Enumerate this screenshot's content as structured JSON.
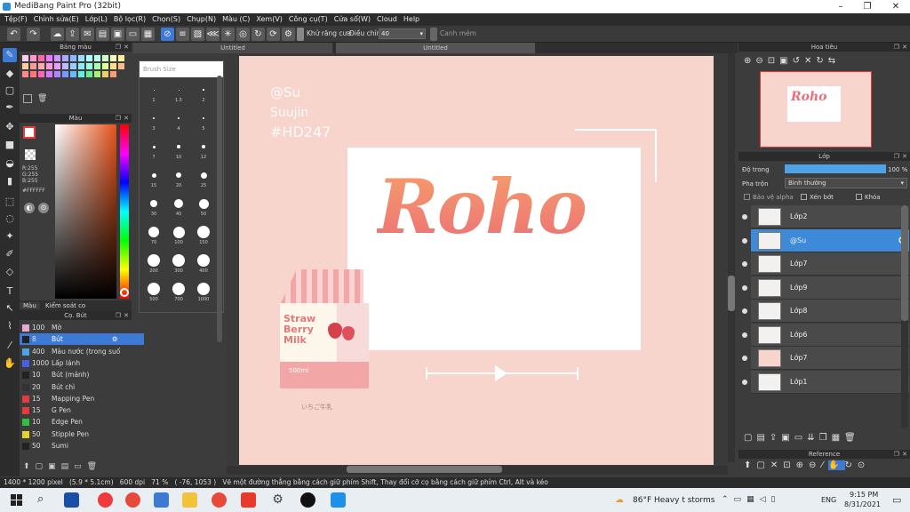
{
  "window": {
    "title": "MediBang Paint Pro (32bit)"
  },
  "menu": [
    "Tệp(F)",
    "Chỉnh sửa(E)",
    "Lớp(L)",
    "Bộ lọc(R)",
    "Chọn(S)",
    "Chụp(N)",
    "Màu (C)",
    "Xem(V)",
    "Công cụ(T)",
    "Cửa sổ(W)",
    "Cloud",
    "Help"
  ],
  "toolbar": {
    "antialias_label": "Khử răng cưa",
    "adjust_label": "Điều chỉnh",
    "adjust_value": "40",
    "snap_label": "Canh mém"
  },
  "palette": {
    "title": "Bảng màu"
  },
  "color": {
    "title": "Màu",
    "rgb": [
      "R:255",
      "G:255",
      "B:255"
    ],
    "hex": "#FFFFFF",
    "tab1": "Màu",
    "tab2": "Kiểm soát co"
  },
  "brush": {
    "title": "Cọ. Bút",
    "items": [
      {
        "size": "100",
        "name": "Mờ",
        "color": "#e8a8d0"
      },
      {
        "size": "8",
        "name": "Bút",
        "color": "#222222"
      },
      {
        "size": "400",
        "name": "Màu nước (trong suố",
        "color": "#49a7e8"
      },
      {
        "size": "1000",
        "name": "Lấp lánh",
        "color": "#4a5ee8"
      },
      {
        "size": "10",
        "name": "Bút (mảnh)",
        "color": "#222222"
      },
      {
        "size": "20",
        "name": "Bút chì",
        "color": "#333333"
      },
      {
        "size": "15",
        "name": "Mapping Pen",
        "color": "#e83a3a"
      },
      {
        "size": "15",
        "name": "G Pen",
        "color": "#e83a3a"
      },
      {
        "size": "10",
        "name": "Edge Pen",
        "color": "#2ec23a"
      },
      {
        "size": "50",
        "name": "Stipple Pen",
        "color": "#e8d22a"
      },
      {
        "size": "50",
        "name": "Sumi",
        "color": "#222222"
      }
    ]
  },
  "brush_size": {
    "title": "Brush Size",
    "labels": [
      "1",
      "1.5",
      "2",
      "3",
      "4",
      "5",
      "7",
      "10",
      "12",
      "15",
      "20",
      "25",
      "30",
      "40",
      "50",
      "70",
      "100",
      "150",
      "200",
      "300",
      "400",
      "500",
      "700",
      "1000"
    ]
  },
  "tabs": [
    "Untitled",
    "Untitled"
  ],
  "canvas": {
    "handle1": "@Su",
    "handle2": "Suujin",
    "tag": "#HD247",
    "title": "Roho",
    "carton_l1": "Straw",
    "carton_l2": "Berry",
    "carton_l3": "Milk",
    "carton_vol": "500ml",
    "jp": "いちご牛乳"
  },
  "navigator": {
    "title": "Hoa tiêu"
  },
  "layers": {
    "title": "Lớp",
    "opacity_label": "Độ trong",
    "opacity_value": "100 %",
    "opacity_frac": 1.0,
    "blend_label": "Pha trộn",
    "blend_value": "Bình thường",
    "protect_alpha": "Bảo vệ alpha",
    "clipping": "Xén bớt",
    "lock": "Khóa",
    "items": [
      {
        "name": "Lớp2",
        "selected": false
      },
      {
        "name": "@Su",
        "selected": true
      },
      {
        "name": "Lớp7",
        "selected": false
      },
      {
        "name": "Lớp9",
        "selected": false
      },
      {
        "name": "Lớp8",
        "selected": false
      },
      {
        "name": "Lớp6",
        "selected": false
      },
      {
        "name": "Lớp7",
        "selected": false
      },
      {
        "name": "Lớp1",
        "selected": false
      }
    ]
  },
  "reference": {
    "title": "Reference"
  },
  "status": {
    "size": "1400 * 1200 pixel",
    "cm": "(5.9 * 5.1cm)",
    "dpi": "600 dpi",
    "zoom": "71 %",
    "coords": "( -76, 1053 )",
    "hint": "Vẽ một đường thẳng bằng cách giữ phím Shift, Thay đổi cỡ cọ bằng cách giữ phím Ctrl, Alt và kéo"
  },
  "taskbar": {
    "weather": "86°F  Heavy t storms",
    "lang": "ENG",
    "time": "9:15 PM",
    "date": "8/31/2021"
  },
  "colors": {
    "accent": "#3d7ad6",
    "canvas_bg": "#f7d4cc",
    "title_grad_top": "#f29a6a",
    "title_grad_bottom": "#e8607a"
  }
}
